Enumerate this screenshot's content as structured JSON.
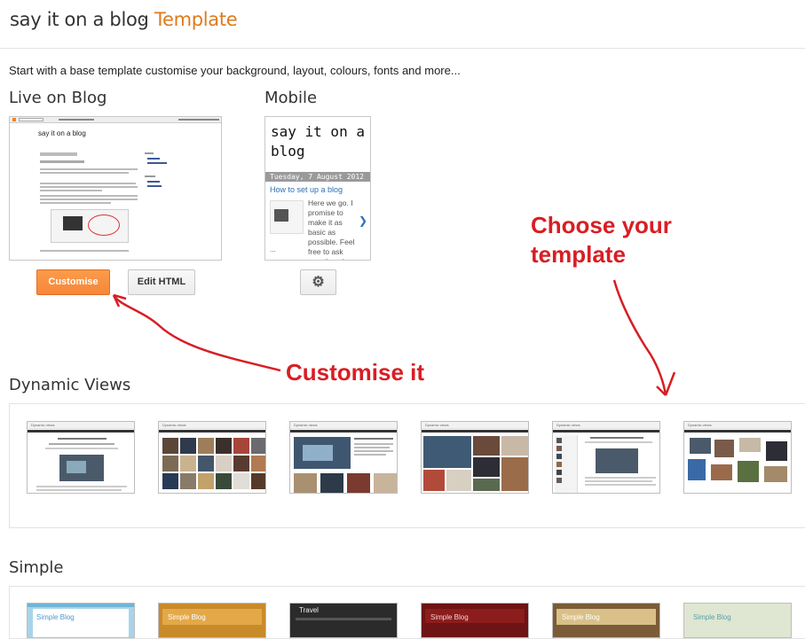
{
  "header": {
    "blog_name": "say it on a blog",
    "separator": "·",
    "section": "Template"
  },
  "intro": "Start with a base template customise your background, layout, colours, fonts and more...",
  "live": {
    "heading": "Live on Blog",
    "preview_title": "say it on a blog",
    "customise_label": "Customise",
    "edit_html_label": "Edit HTML"
  },
  "mobile": {
    "heading": "Mobile",
    "title": "say it on a blog",
    "date": "Tuesday, 7 August 2012",
    "post_title": "How to set up a blog",
    "post_excerpt": "Here we go. I promise to make it as basic as possible. Feel free to ask questions in the comments.",
    "ellipsis": "...",
    "arrow": "❯",
    "settings_icon": "gear-icon"
  },
  "annotations": {
    "choose": "Choose your template",
    "customise": "Customise it",
    "color": "#d81e24"
  },
  "dynamic": {
    "heading": "Dynamic Views",
    "thumb_label": "Dynamic views"
  },
  "simple": {
    "heading": "Simple",
    "labels": [
      "Simple Blog",
      "Simple Blog",
      "Travel",
      "Simple Blog",
      "Simple Blog",
      "Simple Blog"
    ]
  },
  "colors": {
    "accent": "#dd7a1d",
    "button": "#f6863a"
  }
}
